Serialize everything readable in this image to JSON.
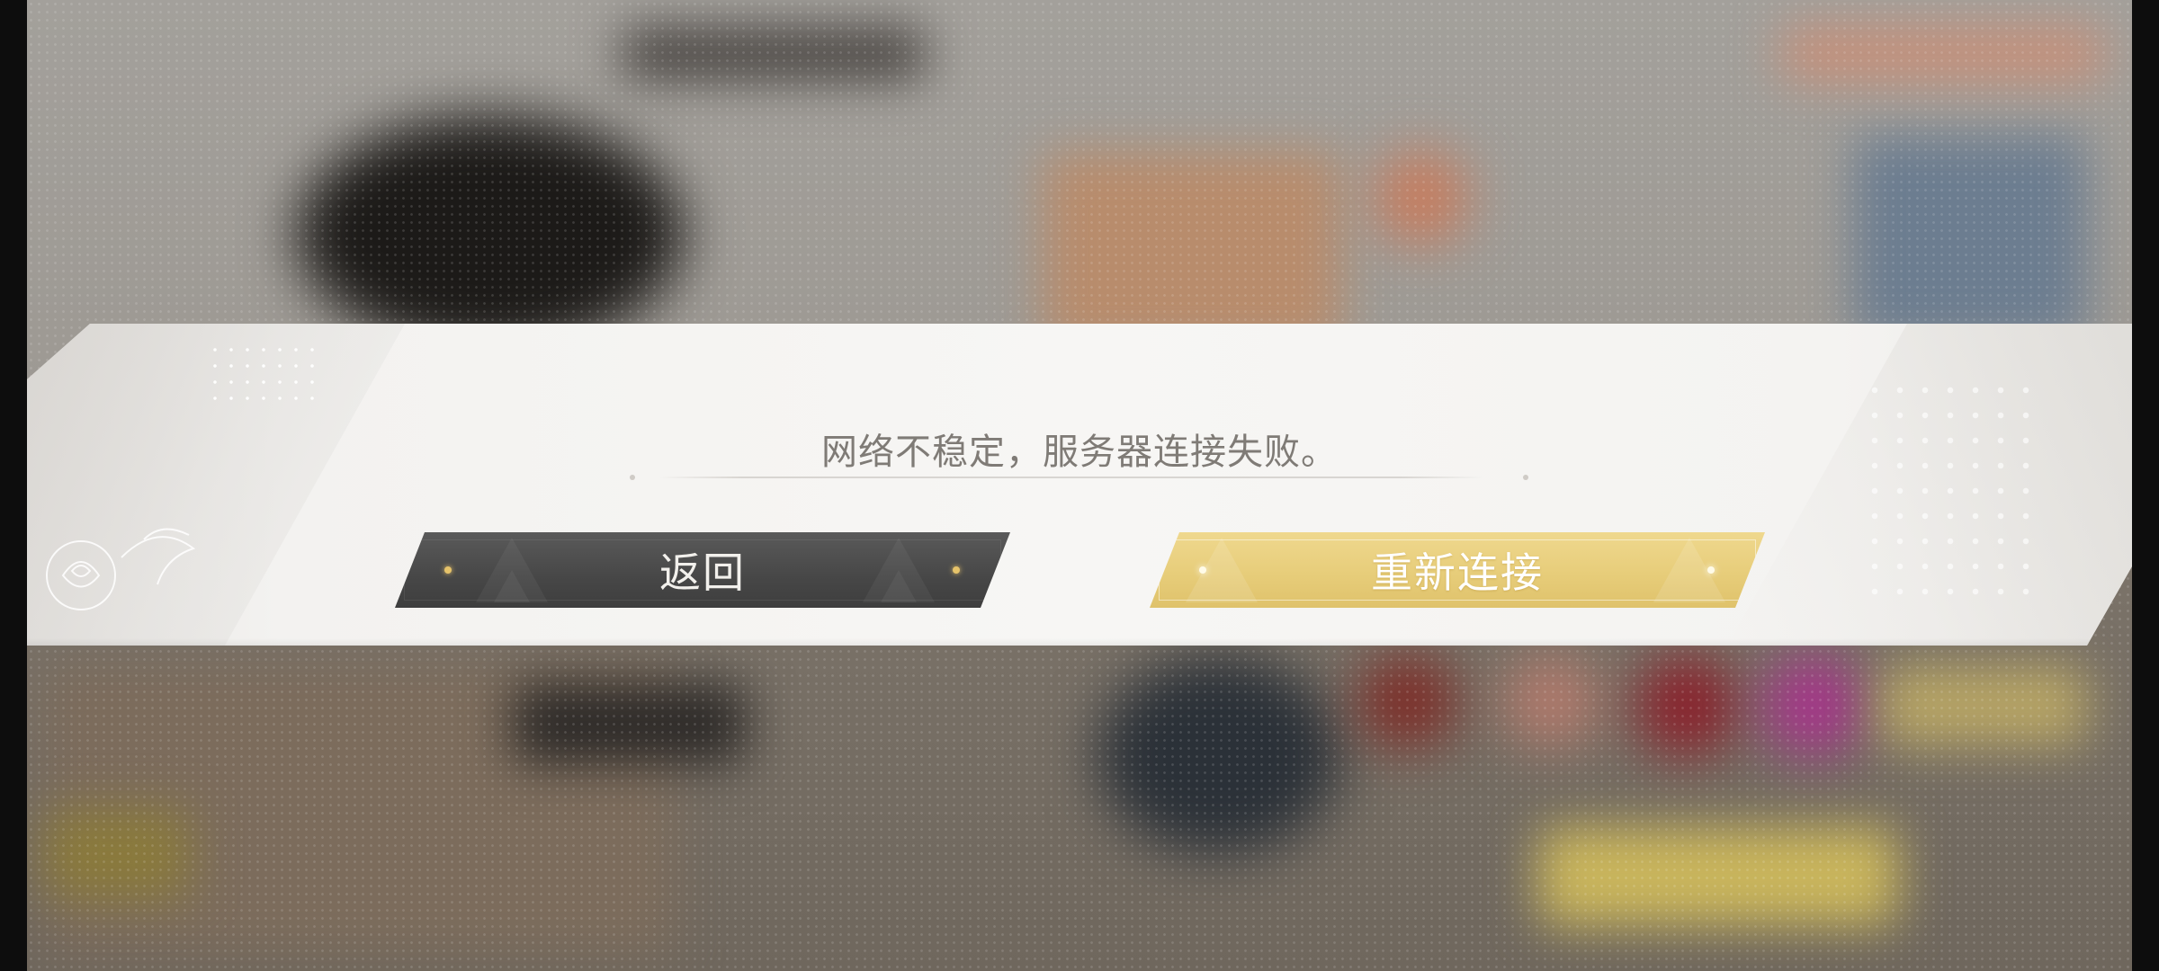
{
  "dialog": {
    "message": "网络不稳定，服务器连接失败。",
    "buttons": {
      "back_label": "返回",
      "reconnect_label": "重新连接"
    }
  },
  "colors": {
    "back_button": "#474747",
    "reconnect_button": "#e7cd7a",
    "message_text": "#7f7b76",
    "band": "#f5f4f2"
  },
  "icons": {
    "background": "blurred-game-scene",
    "decor_left": "rose-outline-icon",
    "decor_dots": "dot-grid-icon",
    "decor_right": "diamond-pattern-icon"
  }
}
